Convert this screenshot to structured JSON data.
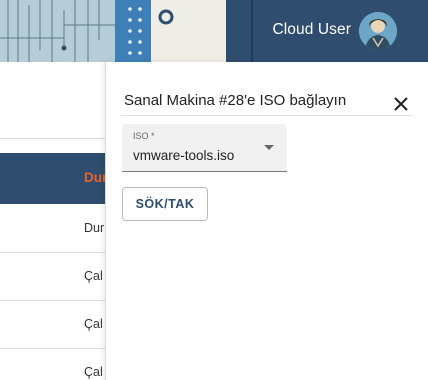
{
  "header": {
    "user_name": "Cloud User",
    "colors": {
      "bar": "#2f4d6e",
      "accent_orange": "#e8622c"
    }
  },
  "table": {
    "status_header": "Dur",
    "rows": [
      "Dur",
      "Çal",
      "Çal",
      "Çal"
    ]
  },
  "dialog": {
    "title": "Sanal Makina #28'e ISO bağlayın",
    "iso_field": {
      "label": "ISO *",
      "value": "vmware-tools.iso"
    },
    "action_label": "SÖK/TAK"
  },
  "icons": {
    "close": "close-icon",
    "dropdown": "arrow-drop-down-icon",
    "avatar": "user-avatar-icon"
  }
}
